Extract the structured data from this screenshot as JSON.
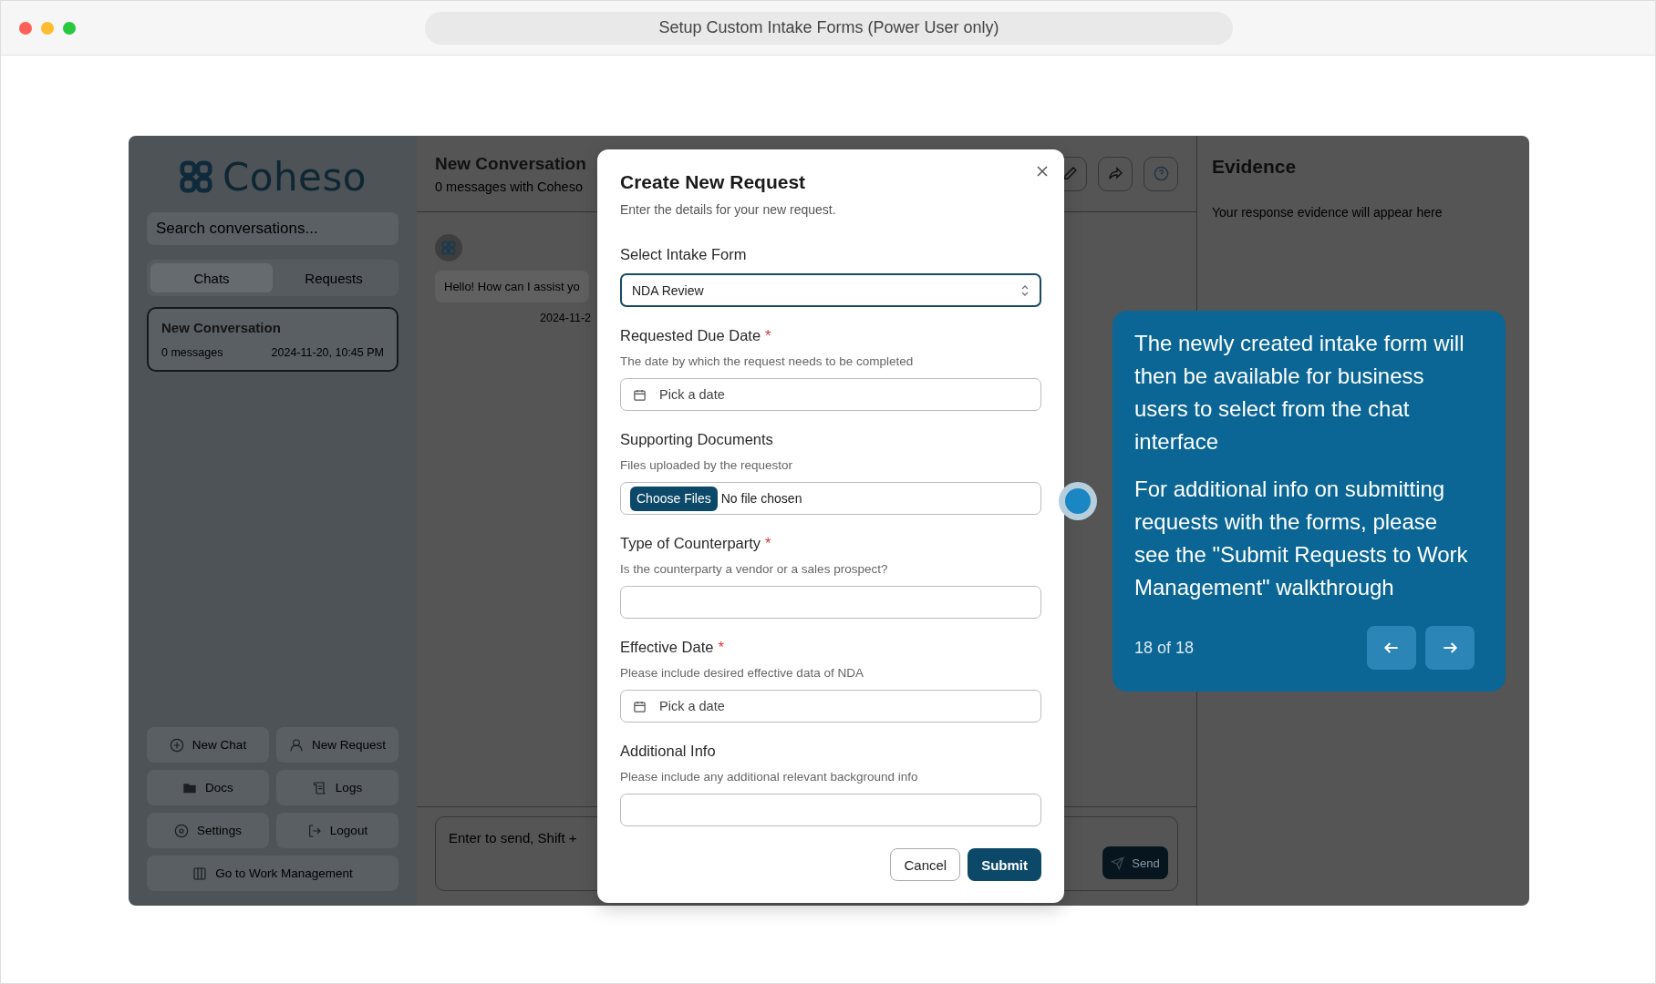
{
  "window": {
    "title": "Setup Custom Intake Forms (Power User only)"
  },
  "sidebar": {
    "logo_text": "Coheso",
    "search": {
      "placeholder": "Search conversations..."
    },
    "tabs": [
      {
        "label": "Chats",
        "selected": true
      },
      {
        "label": "Requests",
        "selected": false
      }
    ],
    "conversations": [
      {
        "title": "New Conversation",
        "count": "0 messages",
        "time": "2024-11-20, 10:45 PM",
        "selected": true
      }
    ],
    "actions": [
      {
        "kind": "plus",
        "label": "New Chat"
      },
      {
        "kind": "user",
        "label": "New Request"
      },
      {
        "kind": "folder",
        "label": "Docs"
      },
      {
        "kind": "scroll",
        "label": "Logs"
      },
      {
        "kind": "gear",
        "label": "Settings"
      },
      {
        "kind": "logout",
        "label": "Logout"
      },
      {
        "kind": "board",
        "label": "Go to Work Management"
      }
    ]
  },
  "chat": {
    "title": "New Conversation",
    "subtitle": "0 messages with Coheso",
    "messages": [
      {
        "text": "Hello! How can I assist yo",
        "time": "2024-11-2"
      }
    ],
    "input": {
      "placeholder": "Enter to send, Shift +"
    },
    "send_label": "Send"
  },
  "evidence": {
    "title": "Evidence",
    "empty_text": "Your response evidence will appear here"
  },
  "modal": {
    "title": "Create New Request",
    "description": "Enter the details for your new request.",
    "fields": [
      {
        "kind": "select",
        "label": "Select Intake Form",
        "value": "NDA Review"
      },
      {
        "kind": "date",
        "label": "Requested Due Date",
        "required_mark": "*",
        "help": "The date by which the request needs to be completed",
        "placeholder": "Pick a date"
      },
      {
        "kind": "file",
        "label": "Supporting Documents",
        "help": "Files uploaded by the requestor",
        "button_label": "Choose Files",
        "status": "No file chosen"
      },
      {
        "kind": "text",
        "label": "Type of Counterparty",
        "required_mark": "*",
        "help": "Is the counterparty a vendor or a sales prospect?"
      },
      {
        "kind": "date",
        "label": "Effective Date",
        "required_mark": "*",
        "help": "Please include desired effective data of NDA",
        "placeholder": "Pick a date"
      },
      {
        "kind": "text",
        "label": "Additional Info",
        "help": "Please include any additional relevant background info"
      }
    ],
    "cancel_label": "Cancel",
    "submit_label": "Submit"
  },
  "tour": {
    "paragraphs": [
      "The newly created intake form will then be available for business users to select from the chat interface",
      "For additional info on submitting requests with the forms, please see the \"Submit Requests to Work Management\" walkthrough"
    ],
    "step": "18 of 18"
  }
}
